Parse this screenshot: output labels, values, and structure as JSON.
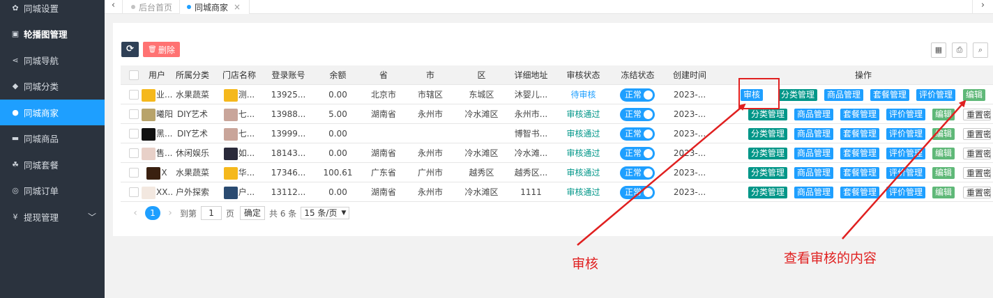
{
  "sidebar": {
    "items": [
      {
        "label": "同城设置",
        "icon": "gear-icon",
        "glyph": "✿"
      },
      {
        "label": "轮播图管理",
        "icon": "image-icon",
        "glyph": "▣"
      },
      {
        "label": "同城导航",
        "icon": "share-icon",
        "glyph": "⋖"
      },
      {
        "label": "同城分类",
        "icon": "tag-icon",
        "glyph": "◆"
      },
      {
        "label": "同城商家",
        "icon": "location-pin-icon",
        "glyph": "●"
      },
      {
        "label": "同城商品",
        "icon": "cart-icon",
        "glyph": "▬"
      },
      {
        "label": "同城套餐",
        "icon": "cubes-icon",
        "glyph": "☘"
      },
      {
        "label": "同城订单",
        "icon": "clock-icon",
        "glyph": "◎"
      },
      {
        "label": "提现管理",
        "icon": "yen-icon",
        "glyph": "¥"
      }
    ],
    "active": "同城商家"
  },
  "tabs": {
    "prev": "‹",
    "next": "›",
    "items": [
      {
        "label": "后台首页"
      },
      {
        "label": "同城商家",
        "close": "×"
      }
    ]
  },
  "toolbar": {
    "refresh_glyph": "⟳",
    "delete_label": "删除",
    "delete_glyph": "🗑"
  },
  "table": {
    "headers": [
      "用户",
      "所属分类",
      "门店名称",
      "登录账号",
      "余额",
      "省",
      "市",
      "区",
      "详细地址",
      "审核状态",
      "冻结状态",
      "创建时间",
      "操作"
    ],
    "rows": [
      {
        "user": "业...",
        "category": "水果蔬菜",
        "store": "测...",
        "account": "13925...",
        "balance": "0.00",
        "province": "北京市",
        "city": "市辖区",
        "district": "东城区",
        "address": "沐婴儿...",
        "audit": "待审核",
        "freeze": "正常",
        "created": "2023-...",
        "ops": [
          "审核",
          "分类管理",
          "商品管理",
          "套餐管理",
          "评价管理",
          "编辑"
        ],
        "avatar_color": "#f5b81c",
        "store_color": "#f5b81c"
      },
      {
        "user": "曦阳",
        "category": "DIY艺术",
        "store": "七...",
        "account": "13988...",
        "balance": "5.00",
        "province": "湖南省",
        "city": "永州市",
        "district": "冷水滩区",
        "address": "永州市...",
        "audit": "审核通过",
        "freeze": "正常",
        "created": "2023-...",
        "ops": [
          "分类管理",
          "商品管理",
          "套餐管理",
          "评价管理",
          "编辑",
          "重置密码"
        ],
        "avatar_color": "#b8a36a",
        "store_color": "#c9a59a"
      },
      {
        "user": "黑...",
        "category": "DIY艺术",
        "store": "七...",
        "account": "13999...",
        "balance": "0.00",
        "province": "",
        "city": "",
        "district": "",
        "address": "博智书...",
        "audit": "审核通过",
        "freeze": "正常",
        "created": "2023-...",
        "ops": [
          "分类管理",
          "商品管理",
          "套餐管理",
          "评价管理",
          "编辑",
          "重置密码"
        ],
        "avatar_color": "#111111",
        "store_color": "#c9a59a"
      },
      {
        "user": "售...",
        "category": "休闲娱乐",
        "store": "如...",
        "account": "18143...",
        "balance": "0.00",
        "province": "湖南省",
        "city": "永州市",
        "district": "冷水滩区",
        "address": "冷水滩...",
        "audit": "审核通过",
        "freeze": "正常",
        "created": "2023-...",
        "ops": [
          "分类管理",
          "商品管理",
          "套餐管理",
          "评价管理",
          "编辑",
          "重置密码"
        ],
        "avatar_color": "#e8d0c8",
        "store_color": "#2a2a3a"
      },
      {
        "user": "X",
        "category": "水果蔬菜",
        "store": "华...",
        "account": "17346...",
        "balance": "100.61",
        "province": "广东省",
        "city": "广州市",
        "district": "越秀区",
        "address": "越秀区...",
        "audit": "审核通过",
        "freeze": "正常",
        "created": "2023-...",
        "ops": [
          "分类管理",
          "商品管理",
          "套餐管理",
          "评价管理",
          "编辑",
          "重置密码"
        ],
        "avatar_color": "#3a2010",
        "store_color": "#f5b81c"
      },
      {
        "user": "XX...",
        "category": "户外探索",
        "store": "户...",
        "account": "13112...",
        "balance": "0.00",
        "province": "湖南省",
        "city": "永州市",
        "district": "冷水滩区",
        "address": "1111",
        "audit": "审核通过",
        "freeze": "正常",
        "created": "2023-...",
        "ops": [
          "分类管理",
          "商品管理",
          "套餐管理",
          "评价管理",
          "编辑",
          "重置密码"
        ],
        "avatar_color": "#f3e8e0",
        "store_color": "#2a4a70"
      }
    ]
  },
  "pagination": {
    "current": "1",
    "goto_label": "到第",
    "page_input": "1",
    "page_unit": "页",
    "confirm": "确定",
    "total": "共 6 条",
    "page_size": "15 条/页",
    "prev": "‹",
    "next": "›"
  },
  "annotations": {
    "audit_label": "审核",
    "view_label": "查看审核的内容",
    "color": "#e02020"
  }
}
